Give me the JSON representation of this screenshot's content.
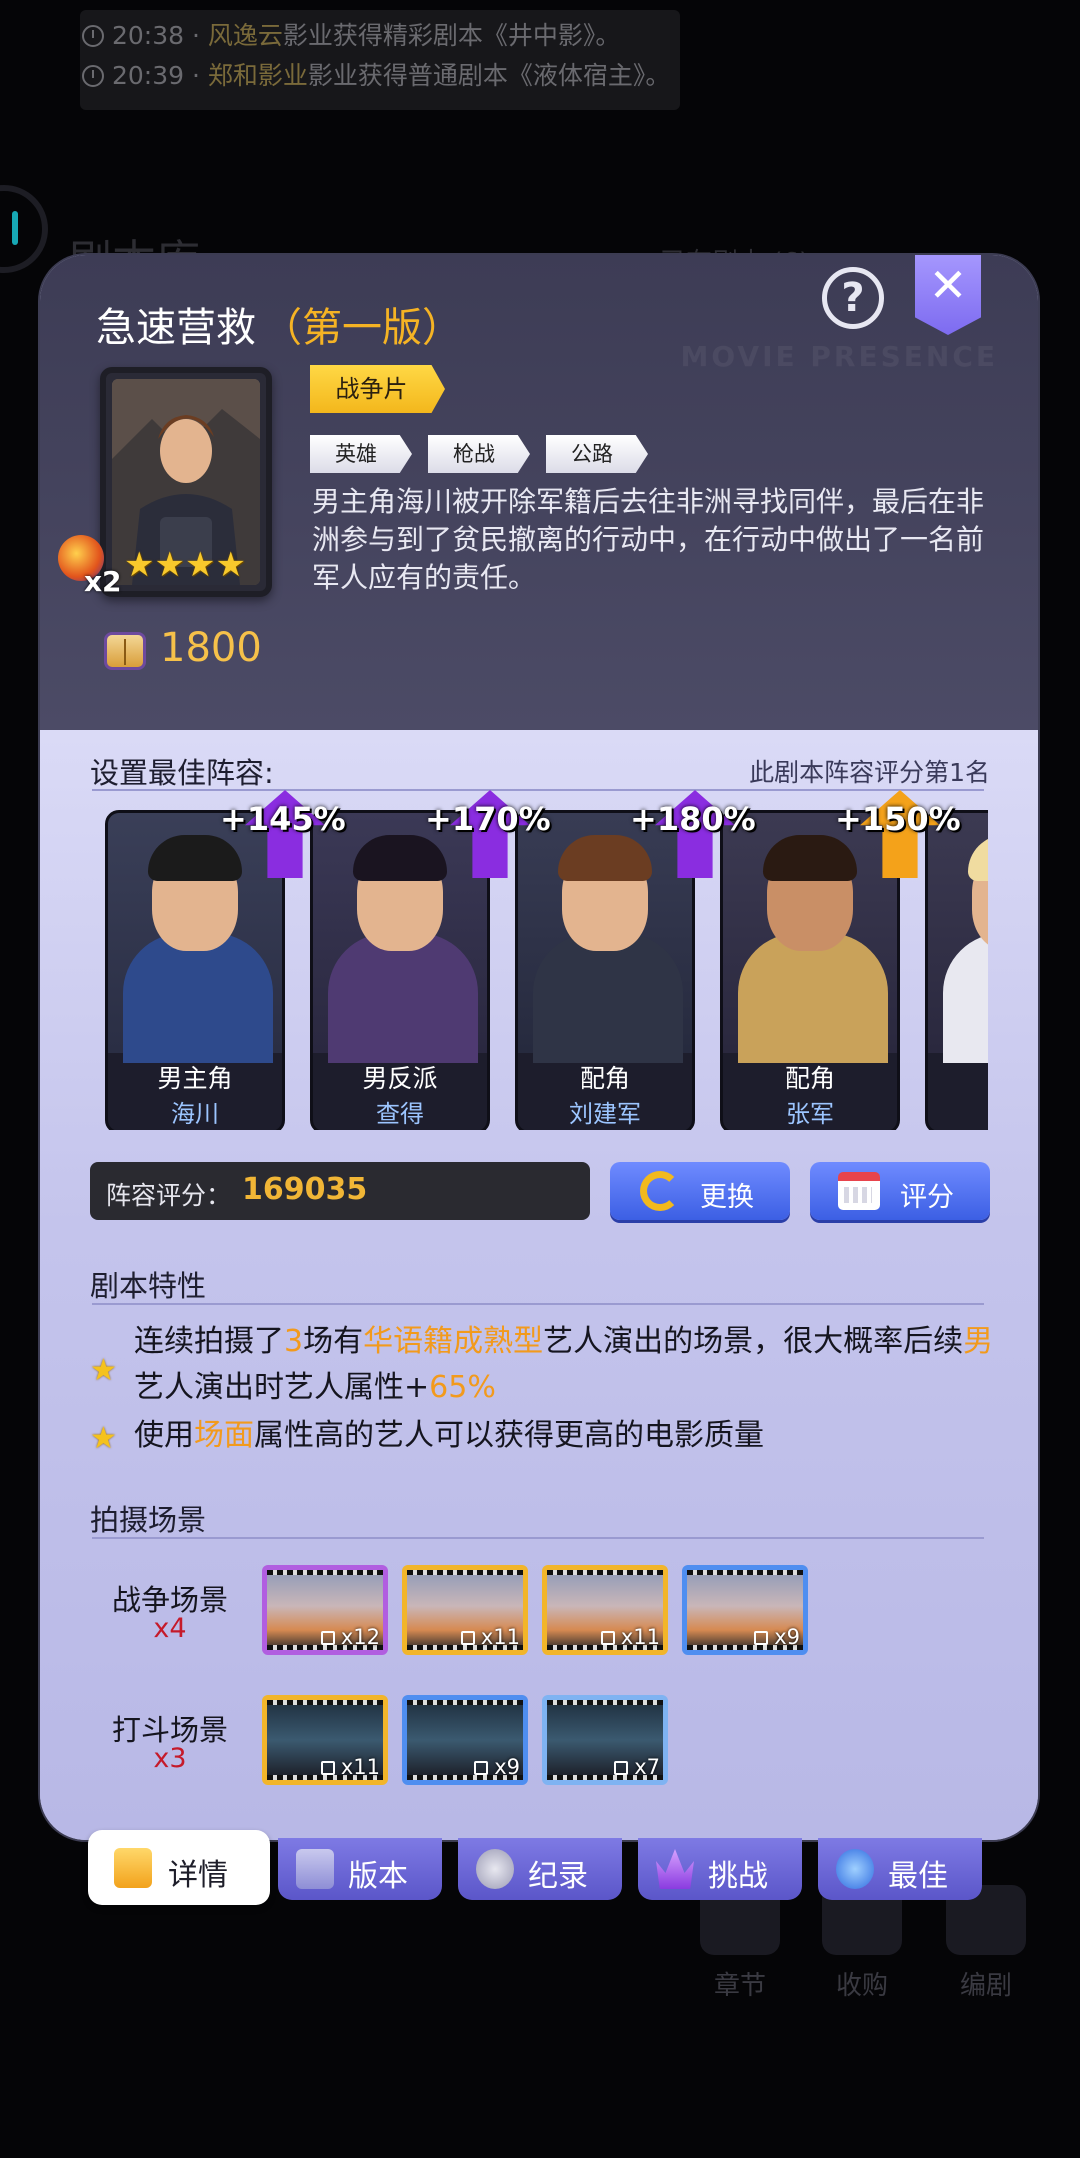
{
  "news": [
    {
      "time": "20:38",
      "company": "风逸云",
      "text": "影业获得精彩剧本《井中影》。"
    },
    {
      "time": "20:39",
      "company": "郑和影业",
      "text": "影业获得普通剧本《液体宿主》。"
    }
  ],
  "background": {
    "title": "剧本库",
    "count_text": "已有剧本 (6)",
    "bottom_nav": [
      "章节",
      "收购",
      "编剧"
    ]
  },
  "script": {
    "title": "急速营救",
    "version": "（第一版）",
    "genre": "战争片",
    "tags": [
      "英雄",
      "枪战",
      "公路"
    ],
    "description": "男主角海川被开除军籍后去往非洲寻找同伴，最后在非洲参与到了贫民撤离的行动中，在行动中做出了一名前军人应有的责任。",
    "stars": 4,
    "multiplier": "x2",
    "book_value": "1800",
    "watermark": "MOVIE PRESENCE"
  },
  "lineup": {
    "header": "设置最佳阵容:",
    "rank_note": "此剧本阵容评分第1名",
    "cast": [
      {
        "role": "男主角",
        "name": "海川",
        "bonus": "+145%",
        "bonus_color": "#8a2de0"
      },
      {
        "role": "男反派",
        "name": "查得",
        "bonus": "+170%",
        "bonus_color": "#8a2de0"
      },
      {
        "role": "配角",
        "name": "刘建军",
        "bonus": "+180%",
        "bonus_color": "#8a2de0"
      },
      {
        "role": "配角",
        "name": "张军",
        "bonus": "+150%",
        "bonus_color": "#f4a21a"
      },
      {
        "role": "",
        "name": "",
        "bonus": "",
        "bonus_color": "#8a2de0"
      }
    ],
    "score_label": "阵容评分：",
    "score_value": "169035",
    "swap_label": "更换",
    "rate_label": "评分"
  },
  "traits": {
    "header": "剧本特性",
    "items": [
      {
        "p1": "连续拍摄了",
        "n": "3",
        "p2": "场有",
        "hl": "华语籍成熟型",
        "p3": "艺人演出的场景，很大概率后续",
        "hl2": "男",
        "p4": "艺人演出时艺人属性+",
        "pct": "65%"
      },
      {
        "p1": "使用",
        "hl": "场面",
        "p2": "属性高的艺人可以获得更高的电影质量"
      }
    ]
  },
  "scenes": {
    "header": "拍摄场景",
    "groups": [
      {
        "label": "战争场景",
        "mult": "x4",
        "tiles": [
          {
            "count": "x12",
            "frame": "#b15ee0"
          },
          {
            "count": "x11",
            "frame": "#f2b52a"
          },
          {
            "count": "x11",
            "frame": "#f2b52a"
          },
          {
            "count": "x9",
            "frame": "#4f8ef0"
          }
        ]
      },
      {
        "label": "打斗场景",
        "mult": "x3",
        "tiles": [
          {
            "count": "x11",
            "frame": "#f2b52a"
          },
          {
            "count": "x9",
            "frame": "#4f8ef0"
          },
          {
            "count": "x7",
            "frame": "#7fb3f2"
          }
        ]
      }
    ]
  },
  "tabs": [
    {
      "label": "详情",
      "active": true
    },
    {
      "label": "版本",
      "active": false
    },
    {
      "label": "纪录",
      "active": false
    },
    {
      "label": "挑战",
      "active": false
    },
    {
      "label": "最佳",
      "active": false
    }
  ],
  "icons": {
    "help": "help-icon",
    "close": "close-icon",
    "refresh": "refresh-icon",
    "calendar": "calendar-icon"
  },
  "help_symbol": "?",
  "close_symbol": "✕"
}
